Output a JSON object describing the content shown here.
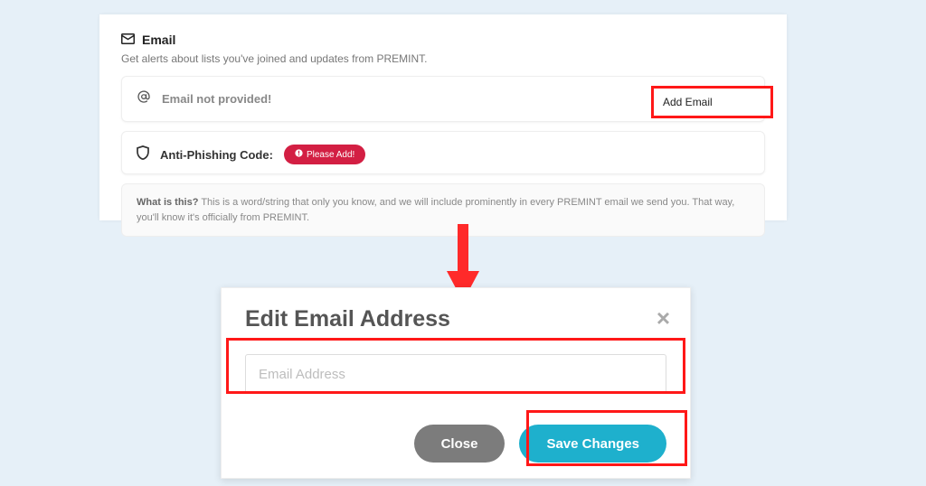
{
  "email": {
    "heading": "Email",
    "sub": "Get alerts about lists you've joined and updates from PREMINT.",
    "not_provided": "Email not provided!",
    "add_button": "Add Email",
    "anti_label": "Anti-Phishing Code:",
    "please_add": "Please Add!",
    "info_title": "What is this?",
    "info_body": "This is a word/string that only you know, and we will include prominently in every PREMINT email we send you. That way, you'll know it's officially from PREMINT."
  },
  "modal": {
    "title": "Edit Email Address",
    "placeholder": "Email Address",
    "close": "Close",
    "save": "Save Changes"
  },
  "colors": {
    "accent_red": "#d31f43",
    "accent_teal": "#1eb0cd",
    "highlight": "#ff1818"
  }
}
